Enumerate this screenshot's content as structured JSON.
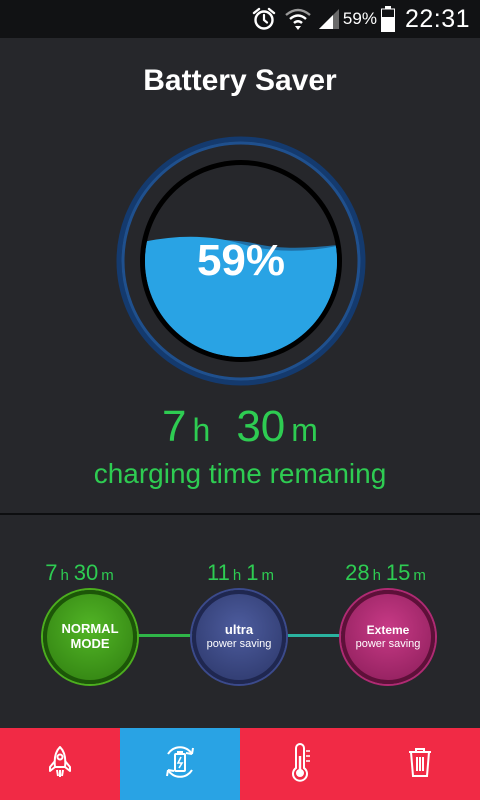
{
  "status_bar": {
    "battery_pct": "59%",
    "time": "22:31"
  },
  "header": {
    "title": "Battery Saver"
  },
  "gauge": {
    "percent_label": "59%",
    "level": 0.59,
    "water_color": "#29a3e4"
  },
  "charging": {
    "hours": "7",
    "hours_unit": "h",
    "minutes": "30",
    "minutes_unit": "m",
    "caption": "charging time remaning"
  },
  "modes": [
    {
      "hours": "7",
      "minutes": "30",
      "h_unit": "h",
      "m_unit": "m",
      "line1": "NORMAL",
      "line2": "MODE",
      "color": "#4caf1e"
    },
    {
      "hours": "11",
      "minutes": "1",
      "h_unit": "h",
      "m_unit": "m",
      "line1": "ultra",
      "line2": "power saving",
      "color": "#3b4a8c"
    },
    {
      "hours": "28",
      "minutes": "15",
      "h_unit": "h",
      "m_unit": "m",
      "line1": "Exteme",
      "line2": "power saving",
      "color": "#b02a73"
    }
  ],
  "bottom_nav": {
    "items": [
      {
        "icon": "rocket-icon"
      },
      {
        "icon": "battery-refresh-icon",
        "active": true
      },
      {
        "icon": "thermometer-icon"
      },
      {
        "icon": "trash-icon"
      }
    ],
    "accent": "#f12a45",
    "active_color": "#29a3e4"
  }
}
